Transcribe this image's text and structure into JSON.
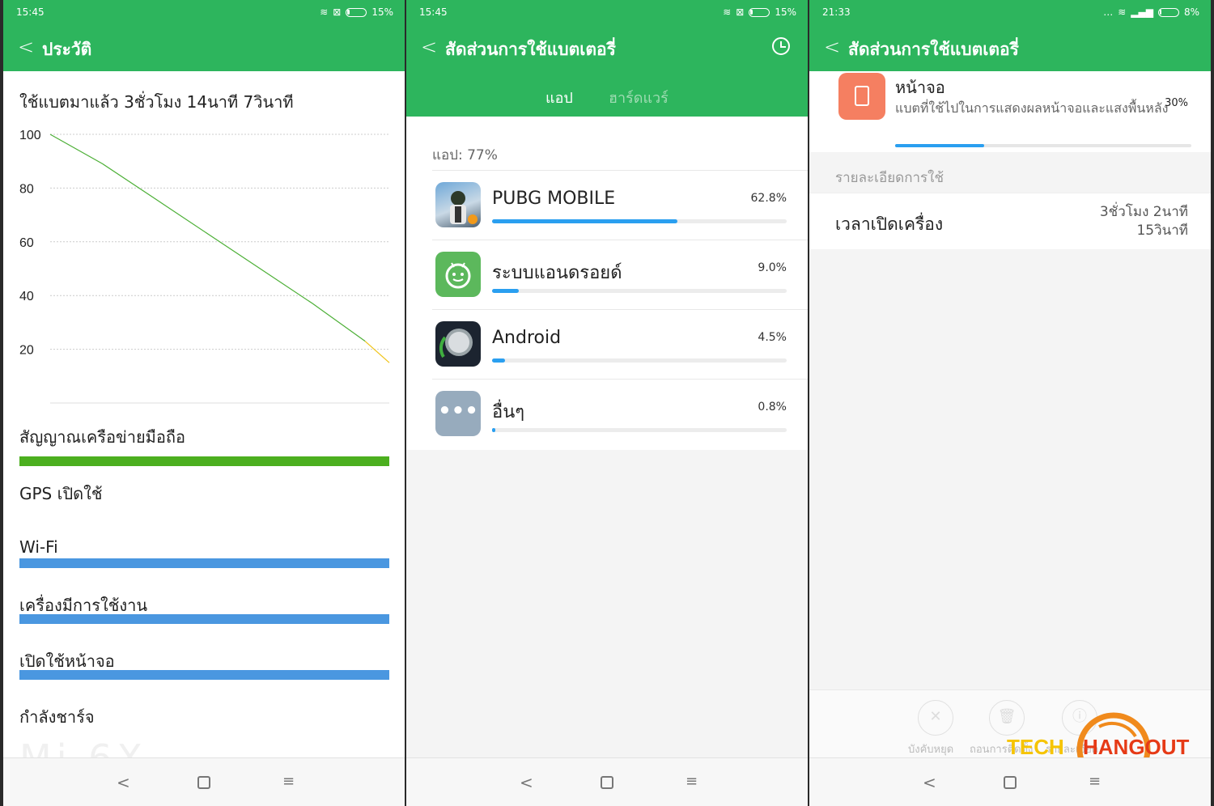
{
  "screen1": {
    "status": {
      "time": "15:45",
      "battery": "15%",
      "battery_level": 0.15
    },
    "header": {
      "title": "ประวัติ"
    },
    "used_time": "ใช้แบตมาแล้ว 3ชั่วโมง 14นาที 7วินาที",
    "chart_data": {
      "type": "line",
      "x": [
        0,
        0.5,
        1,
        1.5,
        2,
        2.5,
        3,
        3.23
      ],
      "y": [
        100,
        89,
        76,
        63,
        50,
        37,
        23,
        15
      ],
      "xlim": [
        0,
        3.23
      ],
      "ylim": [
        0,
        100
      ],
      "yticks": [
        "100",
        "80",
        "60",
        "40",
        "20"
      ],
      "grid": true,
      "colors": {
        "normal": "#4caf36",
        "low": "#f0c419"
      }
    },
    "sections": {
      "signal": "สัญญาณเครือข่ายมือถือ",
      "gps": "GPS เปิดใช้",
      "wifi": "Wi-Fi",
      "active": "เครื่องมีการใช้งาน",
      "screen_on": "เปิดใช้หน้าจอ",
      "charging": "กำลังชาร์จ"
    },
    "watermark": "Mi 6X"
  },
  "screen2": {
    "status": {
      "time": "15:45",
      "battery": "15%",
      "battery_level": 0.15
    },
    "header": {
      "title": "สัดส่วนการใช้แบตเตอรี่"
    },
    "tabs": {
      "app": "แอป",
      "hardware": "ฮาร์ดแวร์"
    },
    "app_label": "แอป: 77%",
    "apps": [
      {
        "name": "PUBG MOBILE",
        "pct": "62.8%",
        "value": 0.628,
        "icon": "pubg-icon"
      },
      {
        "name": "ระบบแอนดรอยด์",
        "pct": "9.0%",
        "value": 0.09,
        "icon": "android-system-icon"
      },
      {
        "name": "Android",
        "pct": "4.5%",
        "value": 0.045,
        "icon": "android-app-icon"
      },
      {
        "name": "อื่นๆ",
        "pct": "0.8%",
        "value": 0.008,
        "icon": "more-icon"
      }
    ]
  },
  "screen3": {
    "status": {
      "time": "21:33",
      "battery": "8%",
      "battery_level": 0.08
    },
    "header": {
      "title": "สัดส่วนการใช้แบตเตอรี่"
    },
    "item": {
      "name": "หน้าจอ",
      "desc": "แบตที่ใช้ไปในการแสดงผลหน้าจอและแสงพื้นหลัง",
      "pct": "30%",
      "value": 0.3
    },
    "detail_label": "รายละเอียดการใช้",
    "detail_key": "เวลาเปิดเครื่อง",
    "detail_value1": "3ชั่วโมง 2นาที",
    "detail_value2": "15วินาที",
    "actions": {
      "force_stop": "บังคับหยุด",
      "uninstall": "ถอนการติดตั้ง",
      "info": "รายละเอียด"
    },
    "logo": {
      "tech": "TECH",
      "hangout": "HANGOUT"
    }
  },
  "colors": {
    "green": "#2db55d",
    "blue": "#2a9ff0",
    "signal_green": "#4caf1f",
    "bar_blue": "#4a97e0",
    "orange": "#f57f61"
  }
}
